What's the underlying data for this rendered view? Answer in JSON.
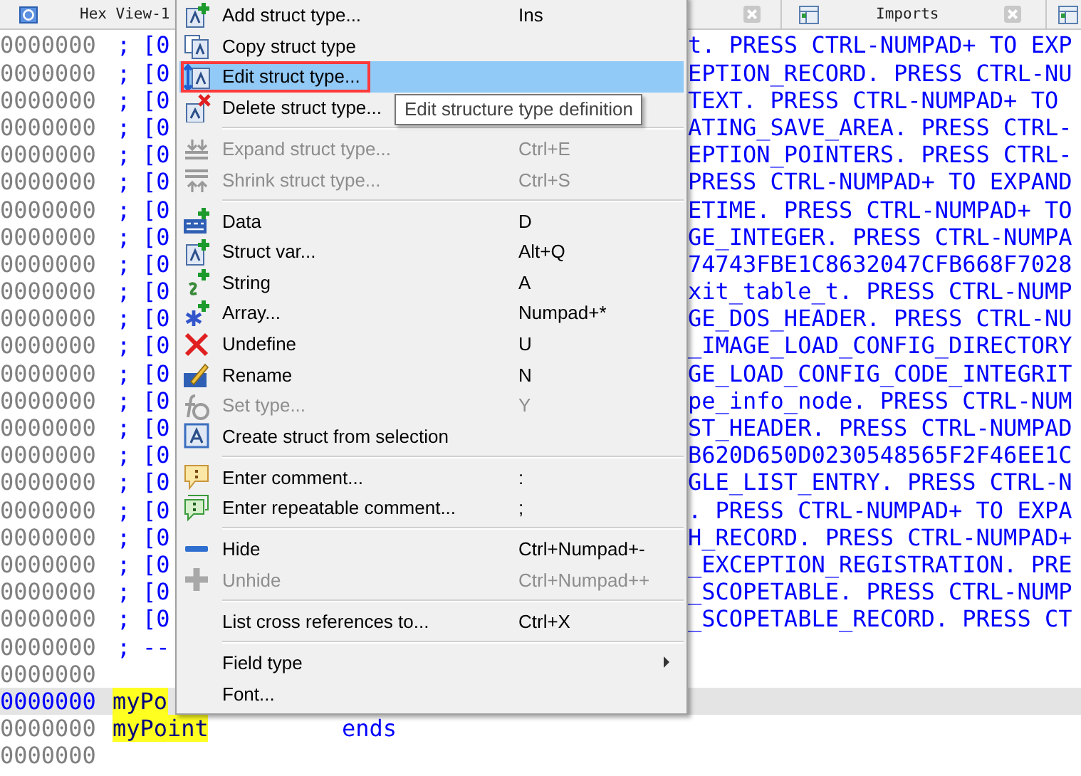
{
  "tabs": [
    {
      "label": "Hex View-1",
      "closable": true
    },
    {
      "label": "Imports",
      "closable": true
    },
    {
      "closable": false
    }
  ],
  "listing": {
    "rows": [
      {
        "kind": "comment",
        "address": "0000000",
        "mark": ";",
        "code": "[0",
        "tail": "t. PRESS CTRL-NUMPAD+ TO EXP"
      },
      {
        "kind": "comment",
        "address": "0000000",
        "mark": ";",
        "code": "[0",
        "tail": "EPTION_RECORD. PRESS CTRL-NU"
      },
      {
        "kind": "comment",
        "address": "0000000",
        "mark": ";",
        "code": "[0",
        "tail": "TEXT. PRESS CTRL-NUMPAD+ TO"
      },
      {
        "kind": "comment",
        "address": "0000000",
        "mark": ";",
        "code": "[0",
        "tail": "ATING_SAVE_AREA. PRESS CTRL-"
      },
      {
        "kind": "comment",
        "address": "0000000",
        "mark": ";",
        "code": "[0",
        "tail": "EPTION_POINTERS. PRESS CTRL-"
      },
      {
        "kind": "comment",
        "address": "0000000",
        "mark": ";",
        "code": "[0",
        "tail": "PRESS CTRL-NUMPAD+ TO EXPAND"
      },
      {
        "kind": "comment",
        "address": "0000000",
        "mark": ";",
        "code": "[0",
        "tail": "ETIME. PRESS CTRL-NUMPAD+ TO"
      },
      {
        "kind": "comment",
        "address": "0000000",
        "mark": ";",
        "code": "[0",
        "tail": "GE_INTEGER. PRESS CTRL-NUMPA"
      },
      {
        "kind": "comment",
        "address": "0000000",
        "mark": ";",
        "code": "[0",
        "tail": "74743FBE1C8632047CFB668F7028"
      },
      {
        "kind": "comment",
        "address": "0000000",
        "mark": ";",
        "code": "[0",
        "tail": "xit_table_t. PRESS CTRL-NUMP"
      },
      {
        "kind": "comment",
        "address": "0000000",
        "mark": ";",
        "code": "[0",
        "tail": "GE_DOS_HEADER. PRESS CTRL-NU"
      },
      {
        "kind": "comment",
        "address": "0000000",
        "mark": ";",
        "code": "[0",
        "tail": "_IMAGE_LOAD_CONFIG_DIRECTORY"
      },
      {
        "kind": "comment",
        "address": "0000000",
        "mark": ";",
        "code": "[0",
        "tail": "GE_LOAD_CONFIG_CODE_INTEGRIT"
      },
      {
        "kind": "comment",
        "address": "0000000",
        "mark": ";",
        "code": "[0",
        "tail": "pe_info_node. PRESS CTRL-NUM"
      },
      {
        "kind": "comment",
        "address": "0000000",
        "mark": ";",
        "code": "[0",
        "tail": "ST_HEADER. PRESS CTRL-NUMPAD"
      },
      {
        "kind": "comment",
        "address": "0000000",
        "mark": ";",
        "code": "[0",
        "tail": "B620D650D0230548565F2F46EE1C"
      },
      {
        "kind": "comment",
        "address": "0000000",
        "mark": ";",
        "code": "[0",
        "tail": "GLE_LIST_ENTRY. PRESS CTRL-N"
      },
      {
        "kind": "comment",
        "address": "0000000",
        "mark": ";",
        "code": "[0",
        "tail": ". PRESS CTRL-NUMPAD+ TO EXPA"
      },
      {
        "kind": "comment",
        "address": "0000000",
        "mark": ";",
        "code": "[0",
        "tail": "H_RECORD. PRESS CTRL-NUMPAD+"
      },
      {
        "kind": "comment",
        "address": "0000000",
        "mark": ";",
        "code": "[0",
        "tail": "_EXCEPTION_REGISTRATION. PRE"
      },
      {
        "kind": "comment",
        "address": "0000000",
        "mark": ";",
        "code": "[0",
        "tail": "_SCOPETABLE. PRESS CTRL-NUMP"
      },
      {
        "kind": "comment",
        "address": "0000000",
        "mark": ";",
        "code": "[0",
        "tail": "_SCOPETABLE_RECORD. PRESS CT"
      },
      {
        "kind": "comment",
        "address": "0000000",
        "mark": ";",
        "code": "--"
      },
      {
        "kind": "blank",
        "address": "0000000"
      },
      {
        "kind": "struct",
        "address": "0000000",
        "name": "myPo",
        "current": true
      },
      {
        "kind": "struct",
        "address": "0000000",
        "name": "myPoint",
        "keyword": "ends",
        "current": false
      },
      {
        "kind": "blank",
        "address": "0000000"
      }
    ]
  },
  "context_menu": {
    "items": [
      {
        "kind": "item",
        "label": "Add struct type...",
        "shortcut": "Ins",
        "disabled": false,
        "selected": false
      },
      {
        "kind": "item",
        "label": "Copy struct type",
        "disabled": false,
        "selected": false
      },
      {
        "kind": "item",
        "label": "Edit struct type...",
        "disabled": false,
        "selected": true,
        "annotated": true
      },
      {
        "kind": "item",
        "label": "Delete struct type...",
        "disabled": false,
        "selected": false
      },
      {
        "kind": "separator"
      },
      {
        "kind": "item",
        "label": "Expand struct type...",
        "shortcut": "Ctrl+E",
        "disabled": true,
        "selected": false
      },
      {
        "kind": "item",
        "label": "Shrink struct type...",
        "shortcut": "Ctrl+S",
        "disabled": true,
        "selected": false
      },
      {
        "kind": "separator"
      },
      {
        "kind": "item",
        "label": "Data",
        "shortcut": "D",
        "disabled": false,
        "selected": false
      },
      {
        "kind": "item",
        "label": "Struct var...",
        "shortcut": "Alt+Q",
        "disabled": false,
        "selected": false
      },
      {
        "kind": "item",
        "label": "String",
        "shortcut": "A",
        "disabled": false,
        "selected": false
      },
      {
        "kind": "item",
        "label": "Array...",
        "shortcut": "Numpad+*",
        "disabled": false,
        "selected": false
      },
      {
        "kind": "item",
        "label": "Undefine",
        "shortcut": "U",
        "disabled": false,
        "selected": false
      },
      {
        "kind": "item",
        "label": "Rename",
        "shortcut": "N",
        "disabled": false,
        "selected": false
      },
      {
        "kind": "item",
        "label": "Set type...",
        "shortcut": "Y",
        "disabled": true,
        "selected": false
      },
      {
        "kind": "item",
        "label": "Create struct from selection",
        "disabled": false,
        "selected": false
      },
      {
        "kind": "separator"
      },
      {
        "kind": "item",
        "label": "Enter comment...",
        "shortcut": ":",
        "disabled": false,
        "selected": false
      },
      {
        "kind": "item",
        "label": "Enter repeatable comment...",
        "shortcut": ";",
        "disabled": false,
        "selected": false
      },
      {
        "kind": "separator"
      },
      {
        "kind": "item",
        "label": "Hide",
        "shortcut": "Ctrl+Numpad+-",
        "disabled": false,
        "selected": false
      },
      {
        "kind": "item",
        "label": "Unhide",
        "shortcut": "Ctrl+Numpad++",
        "disabled": true,
        "selected": false
      },
      {
        "kind": "separator"
      },
      {
        "kind": "item",
        "label": "List cross references to...",
        "shortcut": "Ctrl+X",
        "disabled": false,
        "selected": false
      },
      {
        "kind": "separator"
      },
      {
        "kind": "submenu",
        "label": "Field type",
        "disabled": false,
        "selected": false
      },
      {
        "kind": "item",
        "label": "Font...",
        "disabled": false,
        "selected": false
      }
    ]
  },
  "tooltip": {
    "text": "Edit structure type definition"
  }
}
